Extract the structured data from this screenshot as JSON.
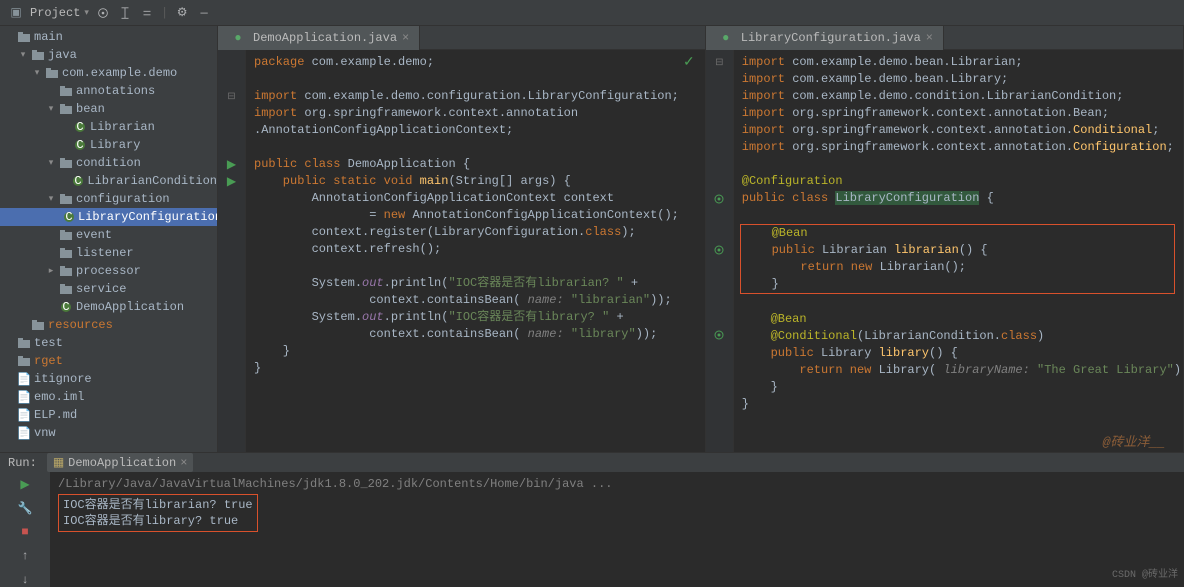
{
  "toolbar": {
    "project_label": "Project"
  },
  "tree": {
    "items": [
      {
        "d": 0,
        "ch": "",
        "ico": "folder",
        "t": "main",
        "cls": ""
      },
      {
        "d": 1,
        "ch": "v",
        "ico": "folder",
        "t": "java",
        "cls": ""
      },
      {
        "d": 2,
        "ch": "v",
        "ico": "pkg",
        "t": "com.example.demo",
        "cls": ""
      },
      {
        "d": 3,
        "ch": "",
        "ico": "pkg",
        "t": "annotations",
        "cls": ""
      },
      {
        "d": 3,
        "ch": "v",
        "ico": "pkg",
        "t": "bean",
        "cls": ""
      },
      {
        "d": 4,
        "ch": "",
        "ico": "class",
        "t": "Librarian",
        "cls": ""
      },
      {
        "d": 4,
        "ch": "",
        "ico": "class",
        "t": "Library",
        "cls": ""
      },
      {
        "d": 3,
        "ch": "v",
        "ico": "pkg",
        "t": "condition",
        "cls": ""
      },
      {
        "d": 4,
        "ch": "",
        "ico": "class",
        "t": "LibrarianCondition",
        "cls": ""
      },
      {
        "d": 3,
        "ch": "v",
        "ico": "pkg",
        "t": "configuration",
        "cls": ""
      },
      {
        "d": 4,
        "ch": "",
        "ico": "class",
        "t": "LibraryConfiguration",
        "cls": "sel"
      },
      {
        "d": 3,
        "ch": "",
        "ico": "pkg",
        "t": "event",
        "cls": ""
      },
      {
        "d": 3,
        "ch": "",
        "ico": "pkg",
        "t": "listener",
        "cls": ""
      },
      {
        "d": 3,
        "ch": ">",
        "ico": "pkg",
        "t": "processor",
        "cls": ""
      },
      {
        "d": 3,
        "ch": "",
        "ico": "pkg",
        "t": "service",
        "cls": ""
      },
      {
        "d": 3,
        "ch": "",
        "ico": "class",
        "t": "DemoApplication",
        "cls": ""
      },
      {
        "d": 1,
        "ch": "",
        "ico": "folder",
        "t": "resources",
        "cls": "rsrc"
      },
      {
        "d": 0,
        "ch": "",
        "ico": "folder",
        "t": "test",
        "cls": ""
      },
      {
        "d": 0,
        "ch": "",
        "ico": "folder",
        "t": "rget",
        "cls": "rsrc"
      },
      {
        "d": 0,
        "ch": "",
        "ico": "file",
        "t": "itignore",
        "cls": ""
      },
      {
        "d": 0,
        "ch": "",
        "ico": "file",
        "t": "emo.iml",
        "cls": ""
      },
      {
        "d": 0,
        "ch": "",
        "ico": "file",
        "t": "ELP.md",
        "cls": ""
      },
      {
        "d": 0,
        "ch": "",
        "ico": "file",
        "t": "vnw",
        "cls": ""
      }
    ]
  },
  "editor_left": {
    "tab": "DemoApplication.java",
    "lines": [
      [
        {
          "t": "package ",
          "c": "kw"
        },
        {
          "t": "com.example.demo;",
          "c": ""
        }
      ],
      [],
      [
        {
          "t": "import ",
          "c": "kw"
        },
        {
          "t": "com.example.demo.configuration.LibraryConfiguration;",
          "c": ""
        }
      ],
      [
        {
          "t": "import ",
          "c": "kw"
        },
        {
          "t": "org.springframework.context.annotation",
          "c": ""
        }
      ],
      [
        {
          "t": ".AnnotationConfigApplicationContext;",
          "c": ""
        }
      ],
      [],
      [
        {
          "t": "public class ",
          "c": "kw"
        },
        {
          "t": "DemoApplication ",
          "c": "cls"
        },
        {
          "t": "{",
          "c": ""
        }
      ],
      [
        {
          "t": "    public static void ",
          "c": "kw"
        },
        {
          "t": "main",
          "c": "fn"
        },
        {
          "t": "(String[] args) {",
          "c": ""
        }
      ],
      [
        {
          "t": "        AnnotationConfigApplicationContext context",
          "c": ""
        }
      ],
      [
        {
          "t": "                = ",
          "c": ""
        },
        {
          "t": "new ",
          "c": "kw"
        },
        {
          "t": "AnnotationConfigApplicationContext();",
          "c": ""
        }
      ],
      [
        {
          "t": "        context.register(LibraryConfiguration.",
          "c": ""
        },
        {
          "t": "class",
          "c": "kw"
        },
        {
          "t": ");",
          "c": ""
        }
      ],
      [
        {
          "t": "        context.refresh();",
          "c": ""
        }
      ],
      [],
      [
        {
          "t": "        System.",
          "c": ""
        },
        {
          "t": "out",
          "c": "fld"
        },
        {
          "t": ".println(",
          "c": ""
        },
        {
          "t": "\"IOC容器是否有librarian? \"",
          "c": "str"
        },
        {
          "t": " +",
          "c": ""
        }
      ],
      [
        {
          "t": "                context.containsBean( ",
          "c": ""
        },
        {
          "t": "name: ",
          "c": "cmt"
        },
        {
          "t": "\"librarian\"",
          "c": "str"
        },
        {
          "t": "));",
          "c": ""
        }
      ],
      [
        {
          "t": "        System.",
          "c": ""
        },
        {
          "t": "out",
          "c": "fld"
        },
        {
          "t": ".println(",
          "c": ""
        },
        {
          "t": "\"IOC容器是否有library? \"",
          "c": "str"
        },
        {
          "t": " +",
          "c": ""
        }
      ],
      [
        {
          "t": "                context.containsBean( ",
          "c": ""
        },
        {
          "t": "name: ",
          "c": "cmt"
        },
        {
          "t": "\"library\"",
          "c": "str"
        },
        {
          "t": "));",
          "c": ""
        }
      ],
      [
        {
          "t": "    }",
          "c": ""
        }
      ],
      [
        {
          "t": "}",
          "c": ""
        }
      ]
    ],
    "gutter": [
      "",
      "",
      "fold",
      "",
      "",
      "",
      "run",
      "run",
      "",
      "",
      "",
      "",
      "",
      "",
      "",
      "",
      "",
      "",
      ""
    ]
  },
  "editor_right": {
    "tab": "LibraryConfiguration.java",
    "lines": [
      [
        {
          "t": "import ",
          "c": "kw"
        },
        {
          "t": "com.example.demo.bean.Librarian;",
          "c": ""
        }
      ],
      [
        {
          "t": "import ",
          "c": "kw"
        },
        {
          "t": "com.example.demo.bean.Library;",
          "c": ""
        }
      ],
      [
        {
          "t": "import ",
          "c": "kw"
        },
        {
          "t": "com.example.demo.condition.LibrarianCondition;",
          "c": ""
        }
      ],
      [
        {
          "t": "import ",
          "c": "kw"
        },
        {
          "t": "org.springframework.context.annotation.Bean;",
          "c": ""
        }
      ],
      [
        {
          "t": "import ",
          "c": "kw"
        },
        {
          "t": "org.springframework.context.annotation.",
          "c": ""
        },
        {
          "t": "Conditional",
          "c": "fn"
        },
        {
          "t": ";",
          "c": ""
        }
      ],
      [
        {
          "t": "import ",
          "c": "kw"
        },
        {
          "t": "org.springframework.context.annotation.",
          "c": ""
        },
        {
          "t": "Configuration",
          "c": "fn"
        },
        {
          "t": ";",
          "c": ""
        }
      ],
      [],
      [
        {
          "t": "@Configuration",
          "c": "ann"
        }
      ],
      [
        {
          "t": "public class ",
          "c": "kw"
        },
        {
          "t": "LibraryConfiguration",
          "c": "hl"
        },
        {
          "t": " {",
          "c": ""
        }
      ],
      [],
      [
        {
          "t": "    @Bean",
          "c": "ann"
        }
      ],
      [
        {
          "t": "    public ",
          "c": "kw"
        },
        {
          "t": "Librarian ",
          "c": ""
        },
        {
          "t": "librarian",
          "c": "fn"
        },
        {
          "t": "() {",
          "c": ""
        }
      ],
      [
        {
          "t": "        return new ",
          "c": "kw"
        },
        {
          "t": "Librarian();",
          "c": ""
        }
      ],
      [
        {
          "t": "    }",
          "c": ""
        }
      ],
      [],
      [
        {
          "t": "    @Bean",
          "c": "ann"
        }
      ],
      [
        {
          "t": "    @Conditional",
          "c": "ann"
        },
        {
          "t": "(LibrarianCondition.",
          "c": ""
        },
        {
          "t": "class",
          "c": "kw"
        },
        {
          "t": ")",
          "c": ""
        }
      ],
      [
        {
          "t": "    public ",
          "c": "kw"
        },
        {
          "t": "Library ",
          "c": ""
        },
        {
          "t": "library",
          "c": "fn"
        },
        {
          "t": "() {",
          "c": ""
        }
      ],
      [
        {
          "t": "        return new ",
          "c": "kw"
        },
        {
          "t": "Library( ",
          "c": ""
        },
        {
          "t": "libraryName: ",
          "c": "cmt"
        },
        {
          "t": "\"The Great Library\"",
          "c": "str"
        },
        {
          "t": ");",
          "c": ""
        }
      ],
      [
        {
          "t": "    }",
          "c": ""
        }
      ],
      [
        {
          "t": "}",
          "c": ""
        }
      ]
    ],
    "gutter": [
      "fold",
      "",
      "",
      "",
      "",
      "",
      "",
      "",
      "bean",
      "",
      "",
      "bean",
      "",
      "",
      "",
      "",
      "bean",
      "",
      "",
      "",
      ""
    ],
    "highlight_box": {
      "start": 10,
      "end": 13
    }
  },
  "run": {
    "label": "Run:",
    "config": "DemoApplication",
    "cmd": "/Library/Java/JavaVirtualMachines/jdk1.8.0_202.jdk/Contents/Home/bin/java ...",
    "out1": "IOC容器是否有librarian? true",
    "out2": "IOC容器是否有library? true"
  },
  "watermark": "@砖业洋__",
  "watermark2": "CSDN @砖业洋"
}
